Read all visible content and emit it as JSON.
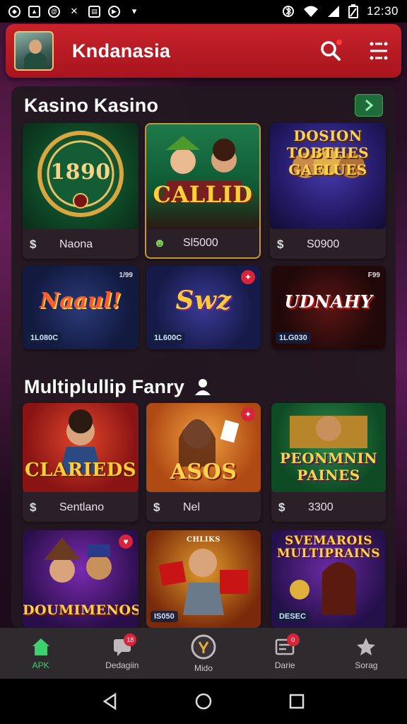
{
  "status_bar": {
    "time": "12:30"
  },
  "header": {
    "title": "Kndanasia",
    "search_icon": "search-icon",
    "menu_icon": "grid-menu-icon"
  },
  "sections": [
    {
      "title": "Kasino Kasino",
      "cards": [
        {
          "thumb_title": "1890",
          "footer_icon": "$",
          "footer_text": "Naona"
        },
        {
          "thumb_title": "CALLID",
          "footer_icon": "☻",
          "footer_text": "Sl5000"
        },
        {
          "thumb_title": "DOSION TOBTHES GAELUES",
          "footer_icon": "$",
          "footer_text": "S0900"
        },
        {
          "thumb_title": "Naaul!",
          "price": "1L080C",
          "corner": "1/99"
        },
        {
          "thumb_title": "Swz",
          "price": "1L600C"
        },
        {
          "thumb_title": "UDNAHY",
          "price": "1LG030",
          "corner": "F99"
        }
      ]
    },
    {
      "title": "Multiplullip Fanry",
      "cards": [
        {
          "thumb_title": "CLARIEDS",
          "footer_icon": "$",
          "footer_text": "Sentlano"
        },
        {
          "thumb_title": "ASOS",
          "footer_icon": "$",
          "footer_text": "Nel"
        },
        {
          "thumb_title": "PEONMNIN PAINES",
          "footer_icon": "$",
          "footer_text": "3300"
        },
        {
          "thumb_title": "DOUMIMENOS"
        },
        {
          "thumb_title": "",
          "price": "IS050",
          "top_tag": "CHLIKS"
        },
        {
          "thumb_title": "SVEMAROIS MULTIPRAINS",
          "price": "DESEC"
        }
      ]
    }
  ],
  "bottom_nav": [
    {
      "label": "APK",
      "icon": "home-icon"
    },
    {
      "label": "Dedagiin",
      "icon": "chat-icon",
      "badge": "18"
    },
    {
      "label": "Mido",
      "icon": "medal-icon"
    },
    {
      "label": "Darie",
      "icon": "ticket-icon",
      "badge": "0"
    },
    {
      "label": "Sorag",
      "icon": "star-icon"
    }
  ],
  "colors": {
    "appbar": "#c8232b",
    "active_nav": "#3ecf71",
    "accent_green": "#1f6b3a"
  }
}
